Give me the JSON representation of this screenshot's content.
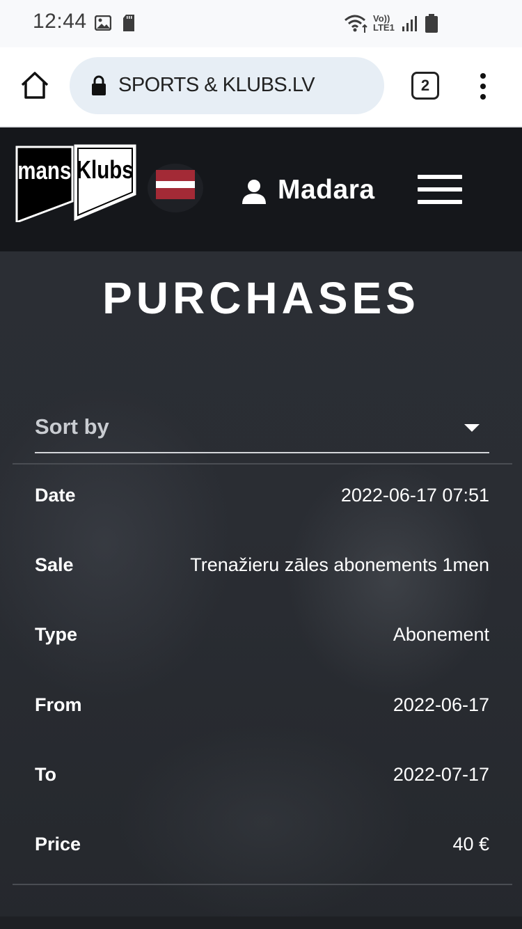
{
  "status_bar": {
    "time": "12:44",
    "icons": [
      "gallery-icon",
      "sd-card-icon",
      "wifi-icon",
      "volte-icon",
      "signal-icon",
      "battery-icon"
    ],
    "volte_text_top": "Vo))",
    "volte_text_bottom": "LTE1"
  },
  "browser": {
    "url": "SPORTS & KLUBS.LV",
    "tab_count": "2",
    "icons": [
      "home-icon",
      "lock-icon",
      "tabs-icon",
      "more-vert-icon"
    ]
  },
  "header": {
    "logo_text": [
      "mans",
      "Klubs"
    ],
    "flag": "latvia-flag-icon",
    "user_name": "Madara",
    "icons": [
      "user-icon",
      "hamburger-menu-icon"
    ]
  },
  "main": {
    "title": "PURCHASES",
    "sort": {
      "label": "Sort by"
    },
    "purchase": [
      {
        "label": "Date",
        "value": "2022-06-17 07:51"
      },
      {
        "label": "Sale",
        "value": "Trenažieru zāles abonements 1men"
      },
      {
        "label": "Type",
        "value": "Abonement"
      },
      {
        "label": "From",
        "value": "2022-06-17"
      },
      {
        "label": "To",
        "value": "2022-07-17"
      },
      {
        "label": "Price",
        "value": "40 €"
      }
    ]
  },
  "colors": {
    "header_bg": "#15171b",
    "flag_red": "#a32a36",
    "text": "#ffffff"
  }
}
